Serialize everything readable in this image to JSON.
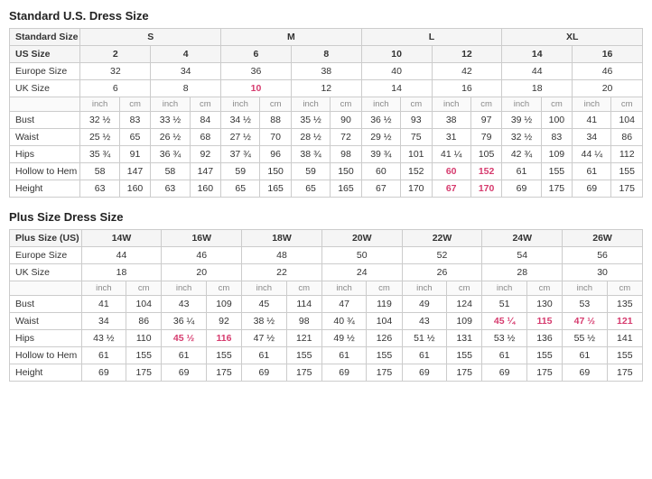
{
  "standard_title": "Standard U.S. Dress Size",
  "plus_title": "Plus Size Dress Size",
  "standard": {
    "size_groups": [
      {
        "label": "Standard Size",
        "cols": [
          "S",
          "",
          "M",
          "",
          "L",
          "",
          "XL",
          ""
        ]
      },
      {
        "label": "US Size",
        "cols": [
          "2",
          "4",
          "6",
          "8",
          "10",
          "12",
          "14",
          "16"
        ],
        "bold": true
      },
      {
        "label": "Europe Size",
        "cols": [
          "32",
          "34",
          "36",
          "38",
          "40",
          "42",
          "44",
          "46"
        ]
      },
      {
        "label": "UK Size",
        "cols": [
          "6",
          "8",
          "10",
          "12",
          "14",
          "16",
          "18",
          "20"
        ],
        "pink_idx": [
          2
        ]
      }
    ],
    "measurement_cols": 8,
    "measurements": [
      {
        "label": "Bust",
        "vals": [
          "32 ½",
          "83",
          "33 ½",
          "84",
          "34 ½",
          "88",
          "35 ½",
          "90",
          "36 ½",
          "93",
          "38",
          "97",
          "39 ½",
          "100",
          "41",
          "104"
        ]
      },
      {
        "label": "Waist",
        "vals": [
          "25 ½",
          "65",
          "26 ½",
          "68",
          "27 ½",
          "70",
          "28 ½",
          "72",
          "29 ½",
          "75",
          "31",
          "79",
          "32 ½",
          "83",
          "34",
          "86"
        ]
      },
      {
        "label": "Hips",
        "vals": [
          "35 ¾",
          "91",
          "36 ¾",
          "92",
          "37 ¾",
          "96",
          "38 ¾",
          "98",
          "39 ¾",
          "101",
          "41 ¼",
          "105",
          "42 ¾",
          "109",
          "44 ¼",
          "112"
        ]
      },
      {
        "label": "Hollow to Hem",
        "vals": [
          "58",
          "147",
          "58",
          "147",
          "59",
          "150",
          "59",
          "150",
          "60",
          "152",
          "60",
          "152",
          "61",
          "155",
          "61",
          "155"
        ],
        "pink_idx": [
          10,
          11
        ]
      },
      {
        "label": "Height",
        "vals": [
          "63",
          "160",
          "63",
          "160",
          "65",
          "165",
          "65",
          "165",
          "67",
          "170",
          "67",
          "170",
          "69",
          "175",
          "69",
          "175"
        ],
        "pink_idx": [
          10,
          11
        ]
      }
    ]
  },
  "plus": {
    "size_groups": [
      {
        "label": "Plus Size (US)",
        "cols": [
          "14W",
          "16W",
          "18W",
          "20W",
          "22W",
          "24W",
          "26W"
        ],
        "bold": true
      },
      {
        "label": "Europe Size",
        "cols": [
          "44",
          "46",
          "48",
          "50",
          "52",
          "54",
          "56"
        ]
      },
      {
        "label": "UK Size",
        "cols": [
          "18",
          "20",
          "22",
          "24",
          "26",
          "28",
          "30"
        ]
      }
    ],
    "measurements": [
      {
        "label": "Bust",
        "vals": [
          "41",
          "104",
          "43",
          "109",
          "45",
          "114",
          "47",
          "119",
          "49",
          "124",
          "51",
          "130",
          "53",
          "135"
        ]
      },
      {
        "label": "Waist",
        "vals": [
          "34",
          "86",
          "36 ¼",
          "92",
          "38 ½",
          "98",
          "40 ¾",
          "104",
          "43",
          "109",
          "45 ¼",
          "115",
          "47 ½",
          "121"
        ],
        "pink_idx": [
          10,
          11,
          12,
          13
        ]
      },
      {
        "label": "Hips",
        "vals": [
          "43 ½",
          "110",
          "45 ½",
          "116",
          "47 ½",
          "121",
          "49 ½",
          "126",
          "51 ½",
          "131",
          "53 ½",
          "136",
          "55 ½",
          "141"
        ],
        "pink_idx": [
          2,
          3
        ]
      },
      {
        "label": "Hollow to Hem",
        "vals": [
          "61",
          "155",
          "61",
          "155",
          "61",
          "155",
          "61",
          "155",
          "61",
          "155",
          "61",
          "155",
          "61",
          "155"
        ]
      },
      {
        "label": "Height",
        "vals": [
          "69",
          "175",
          "69",
          "175",
          "69",
          "175",
          "69",
          "175",
          "69",
          "175",
          "69",
          "175",
          "69",
          "175"
        ]
      }
    ]
  }
}
